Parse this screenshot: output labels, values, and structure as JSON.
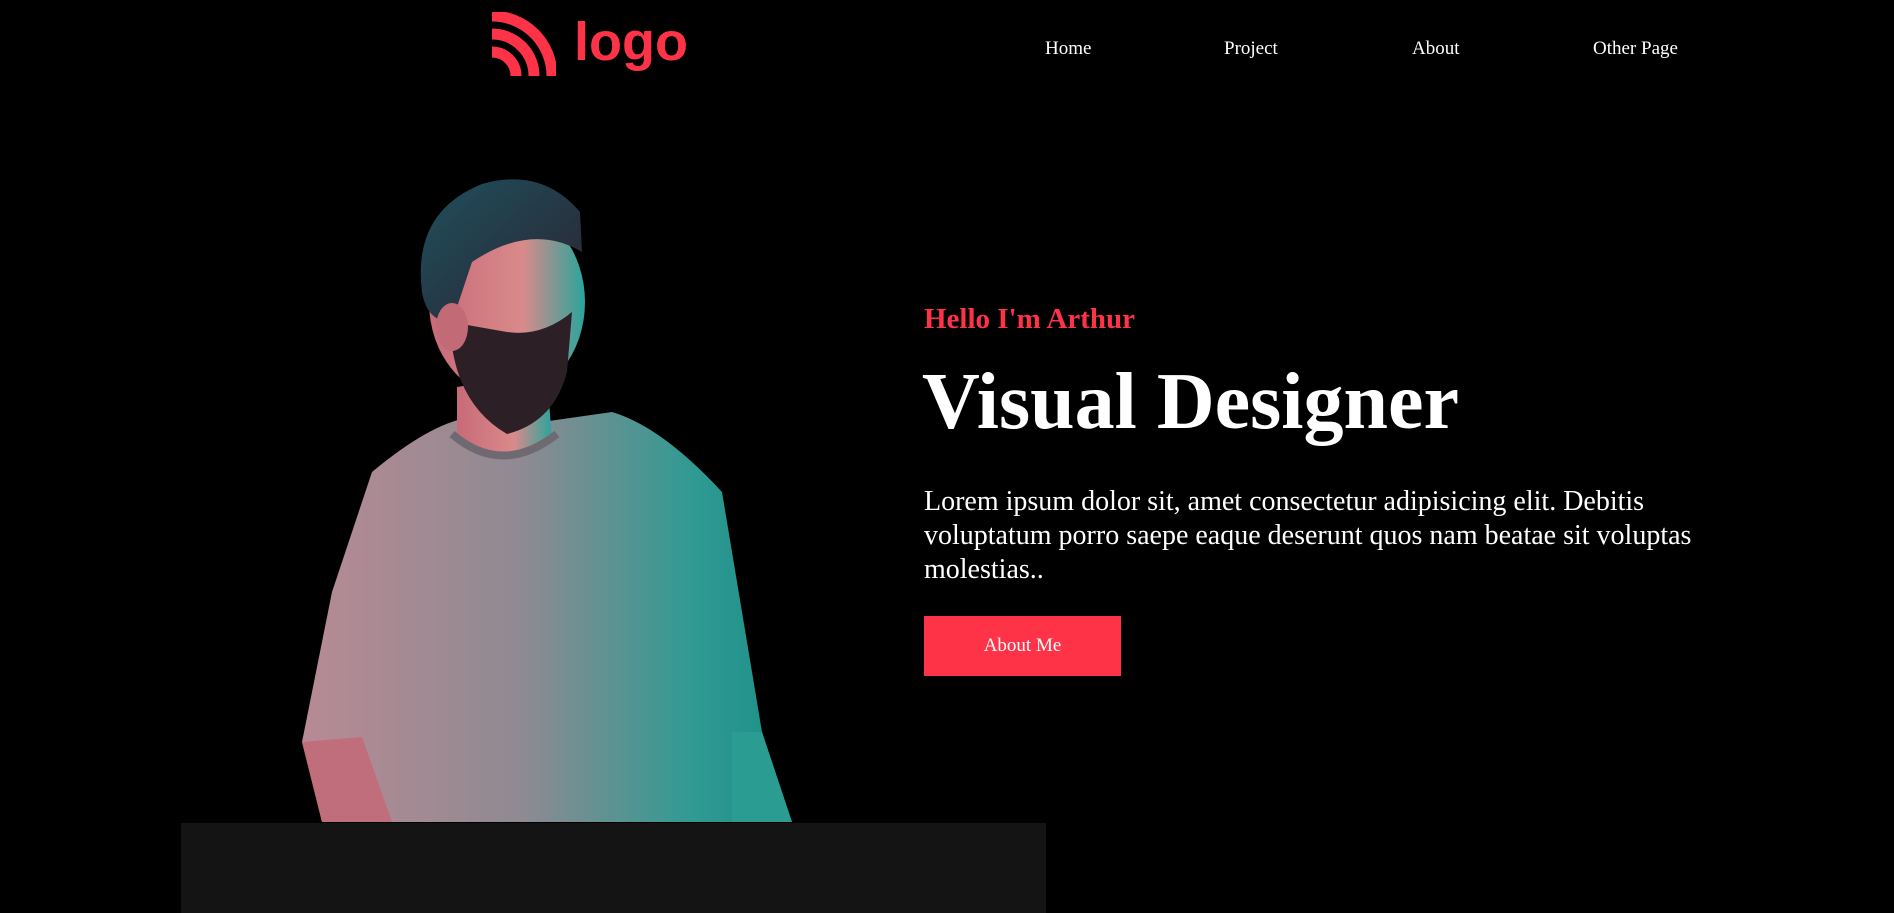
{
  "brand": {
    "logo_text": "logo",
    "logo_icon": "rss-arcs-icon",
    "accent_color": "#ff3347"
  },
  "nav": {
    "items": [
      {
        "label": "Home"
      },
      {
        "label": "Project"
      },
      {
        "label": "About"
      },
      {
        "label": "Other Page"
      }
    ]
  },
  "hero": {
    "greeting": "Hello I'm Arthur",
    "title": "Visual Designer",
    "description": "Lorem ipsum dolor sit, amet consectetur adipisicing elit. Debitis voluptatum porro saepe eaque deserunt quos nam beatae sit voluptas molestias..",
    "cta_label": "About Me",
    "portrait": "portrait-of-bearded-man-in-grey-tshirt"
  }
}
